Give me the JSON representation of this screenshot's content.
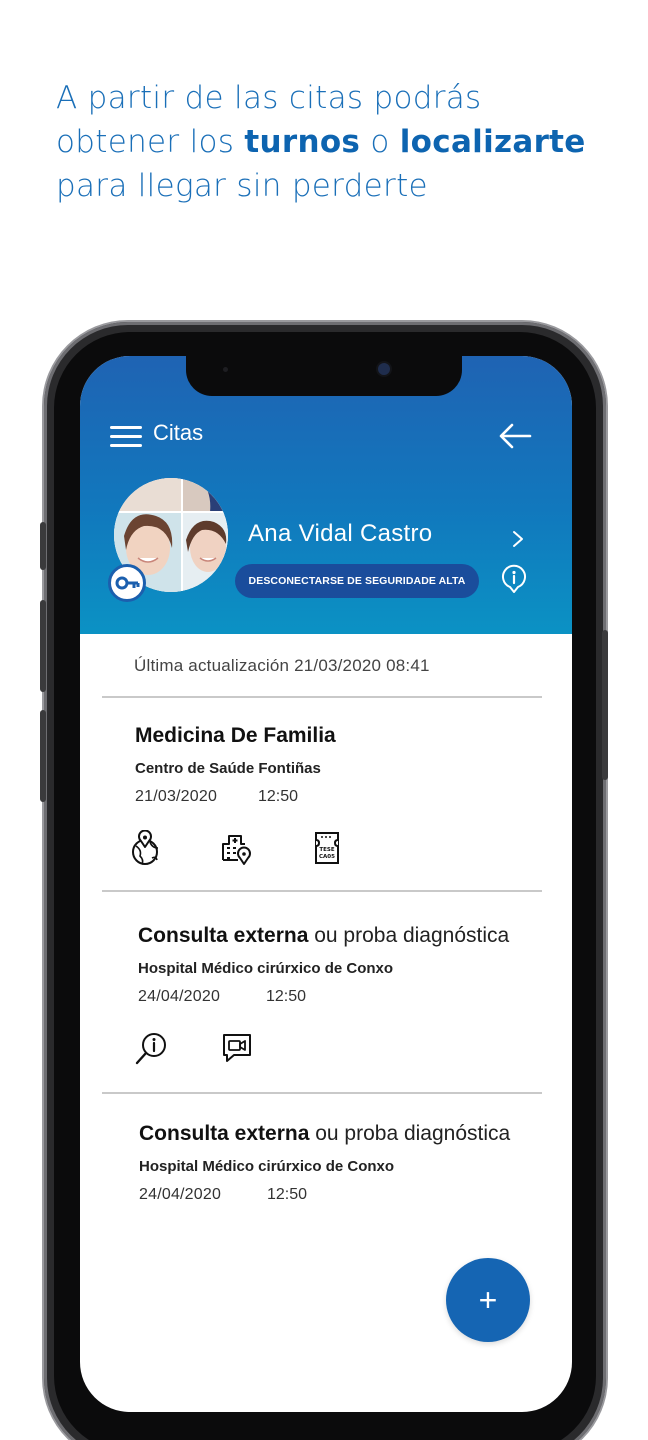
{
  "headline": {
    "part1": "A partir de las citas podrás",
    "part2": "obtener los ",
    "bold1": "turnos",
    "part3": " o ",
    "bold2": "localizarte",
    "part4": "para llegar sin perderte"
  },
  "app": {
    "title": "Citas",
    "user_name": "Ana Vidal Castro",
    "disconnect_label": "DESCONECTARSE DE SEGURIDADE ALTA",
    "last_update": "Última actualización 21/03/2020  08:41",
    "fab_label": "+"
  },
  "appointments": [
    {
      "title": "Medicina De Familia",
      "title_bold": "",
      "title_rest": "",
      "center": "Centro de Saúde Fontiñas",
      "date": "21/03/2020",
      "time": "12:50",
      "icons": [
        "map-location-icon",
        "hospital-location-icon",
        "ticket-turn-icon"
      ]
    },
    {
      "title": "",
      "title_bold": "Consulta externa",
      "title_rest": " ou proba diagnóstica",
      "center": "Hospital Médico cirúrxico de Conxo",
      "date": "24/04/2020",
      "time": "12:50",
      "icons": [
        "info-search-icon",
        "video-call-icon"
      ]
    },
    {
      "title": "",
      "title_bold": "Consulta externa",
      "title_rest": " ou proba diagnóstica",
      "center": "Hospital Médico cirúrxico de Conxo",
      "date": "24/04/2020",
      "time": "12:50",
      "icons": []
    }
  ],
  "colors": {
    "headline": "#1a6fb8",
    "header_top": "#1f63b3",
    "header_bottom": "#0b92c4",
    "button": "#1a4d9c",
    "fab": "#1565b3"
  }
}
